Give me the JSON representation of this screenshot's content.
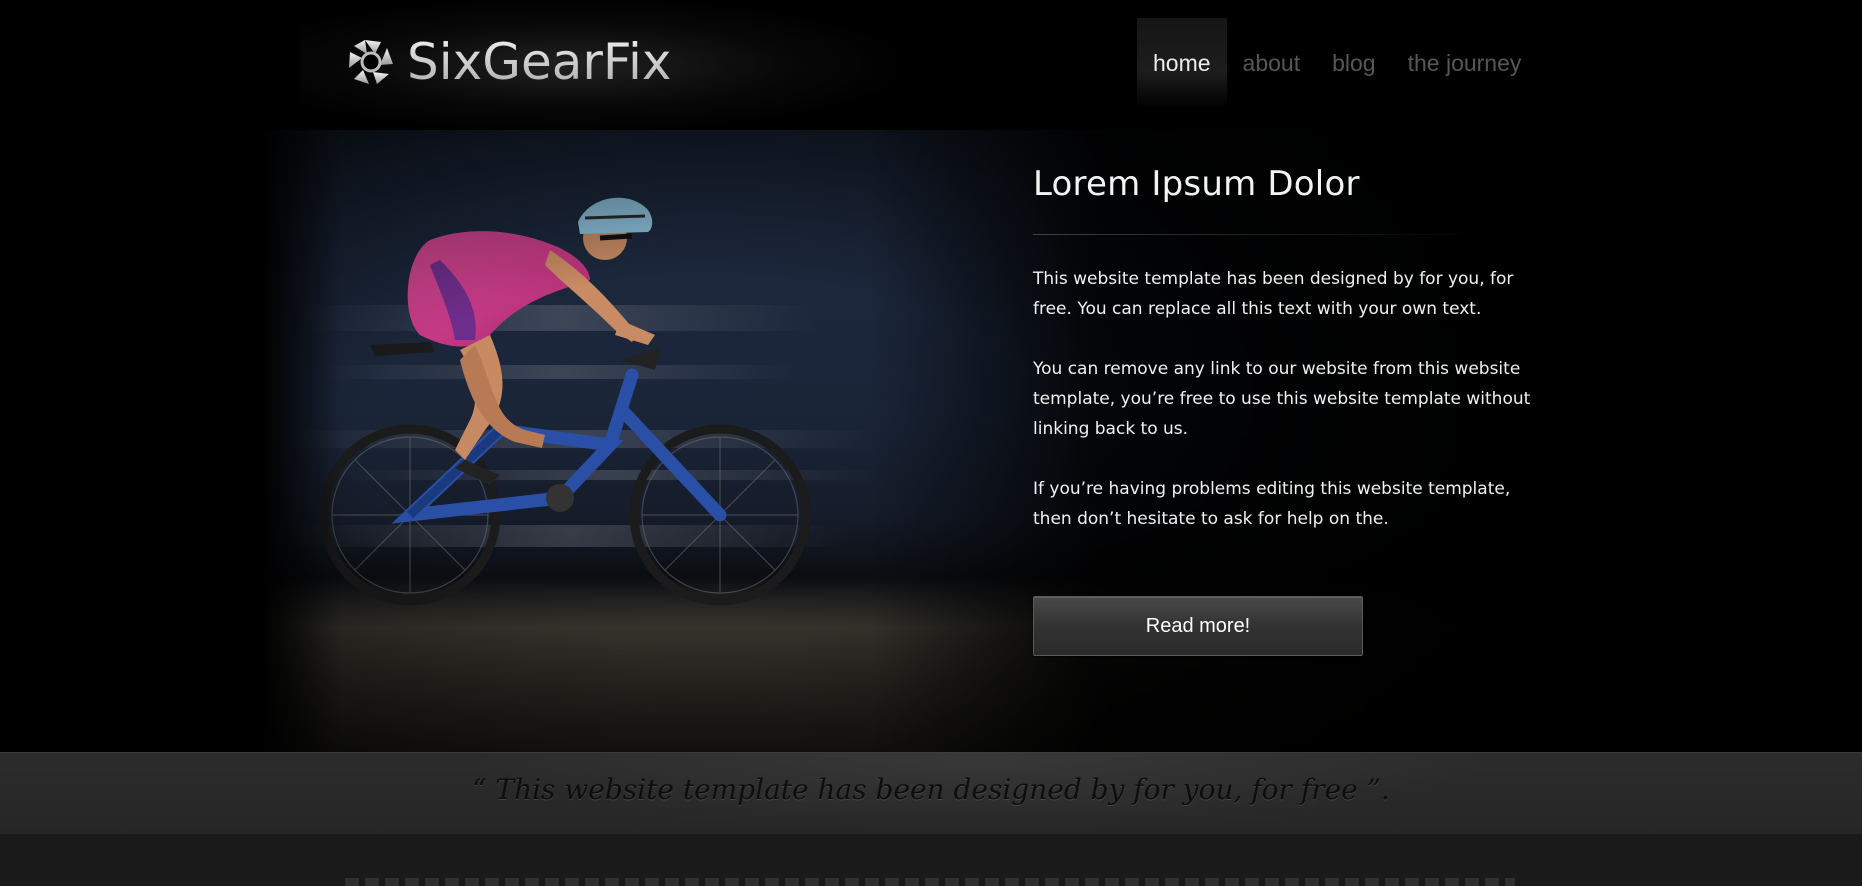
{
  "header": {
    "logo_text": "SixGearFix",
    "logo_icon": "gear-aperture-icon",
    "nav": [
      {
        "label": "home",
        "active": true
      },
      {
        "label": "about",
        "active": false
      },
      {
        "label": "blog",
        "active": false
      },
      {
        "label": "the journey",
        "active": false
      }
    ]
  },
  "hero": {
    "image": "cyclist-photo",
    "title": "Lorem Ipsum Dolor",
    "paragraphs": [
      "This website template has been designed by for you, for free. You can replace all this text with your own text.",
      "You can remove any link to our website from this website template, you’re free to use this website template without linking back to us.",
      "If you’re having problems editing this website template, then don’t hesitate to ask for help on the."
    ],
    "button_label": "Read more!"
  },
  "quote": {
    "text": "“ This website template has been designed by for you, for free ”."
  },
  "colors": {
    "background": "#000000",
    "nav_active": "#ececec",
    "nav_inactive": "#575757",
    "quote_band": "#2a2a2a",
    "jersey_pink": "#d93a8f",
    "bike_blue": "#1f3f8f"
  }
}
